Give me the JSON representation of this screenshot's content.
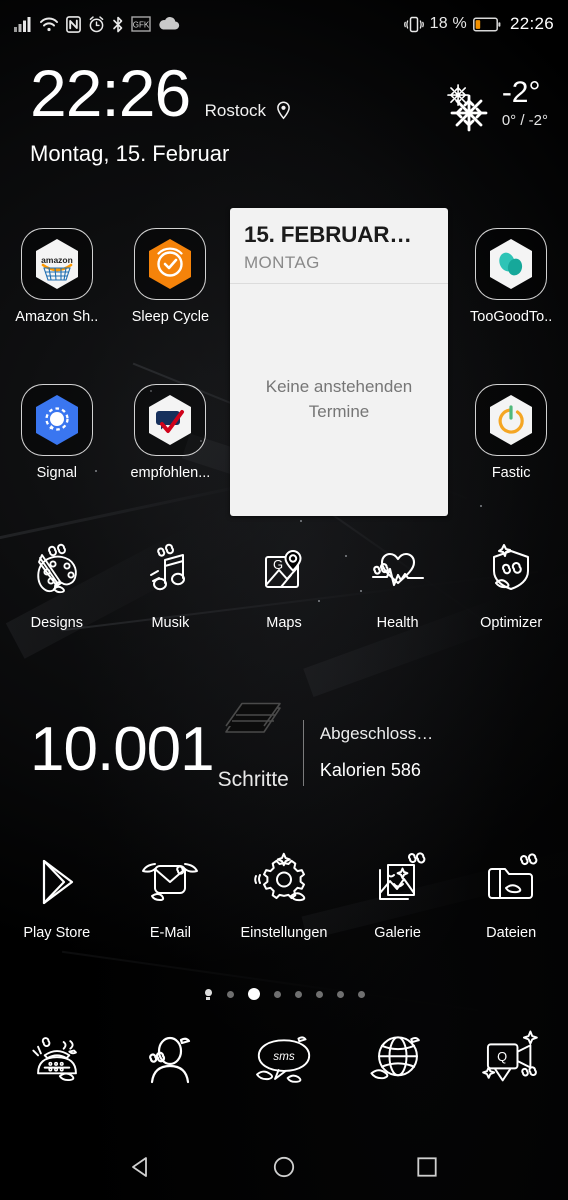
{
  "statusbar": {
    "left_icons": [
      "signal-bars-icon",
      "wifi-icon",
      "nfc-icon",
      "alarm-icon",
      "bluetooth-icon",
      "gfk-icon",
      "cloud-icon"
    ],
    "gfk_label": "GFK",
    "battery_percent": "18 %",
    "time": "22:26",
    "vibrate_icon": "vibrate-icon",
    "battery_icon": "battery-low-icon",
    "battery_color": "#f29100"
  },
  "clock_widget": {
    "time": "22:26",
    "city": "Rostock",
    "location_icon": "location-pin-icon",
    "date": "Montag, 15. Februar"
  },
  "weather_widget": {
    "icon": "snowflake-icon",
    "temperature": "-2°",
    "range": "0° / -2°"
  },
  "calendar_widget": {
    "date": "15. FEBRUAR…",
    "weekday": "MONTAG",
    "empty_message": "Keine anstehenden Termine"
  },
  "steps_widget": {
    "count": "10.001",
    "unit": "Schritte",
    "goal": "Abgeschloss…",
    "calories": "Kalorien 586",
    "book_icon": "book-stack-icon"
  },
  "rows": [
    {
      "name": "app-row-1",
      "apps": [
        {
          "label": "Amazon Sh..",
          "icon": "amazon-shopping-icon",
          "style": "hex-white"
        },
        {
          "label": "Sleep Cycle",
          "icon": "sleep-cycle-icon",
          "style": "hex-orange"
        },
        {
          "label": "",
          "icon": "",
          "style": "spacer"
        },
        {
          "label": "",
          "icon": "",
          "style": "spacer"
        },
        {
          "label": "TooGoodTo..",
          "icon": "toogoodtogo-icon",
          "style": "hex-white"
        }
      ]
    },
    {
      "name": "app-row-2",
      "apps": [
        {
          "label": "Signal",
          "icon": "signal-app-icon",
          "style": "hex-blue"
        },
        {
          "label": "empfohlen...",
          "icon": "empfohlen-icon",
          "style": "hex-white"
        },
        {
          "label": "",
          "icon": "",
          "style": "spacer"
        },
        {
          "label": "",
          "icon": "",
          "style": "spacer"
        },
        {
          "label": "Fastic",
          "icon": "fastic-icon",
          "style": "hex-white"
        }
      ]
    },
    {
      "name": "app-row-3",
      "apps": [
        {
          "label": "Designs",
          "icon": "palette-icon",
          "style": "line"
        },
        {
          "label": "Musik",
          "icon": "music-note-icon",
          "style": "line"
        },
        {
          "label": "Maps",
          "icon": "maps-icon",
          "style": "line"
        },
        {
          "label": "Health",
          "icon": "heart-pulse-icon",
          "style": "line"
        },
        {
          "label": "Optimizer",
          "icon": "shield-icon",
          "style": "line"
        }
      ]
    },
    {
      "name": "app-row-4",
      "apps": [
        {
          "label": "Play Store",
          "icon": "play-store-icon",
          "style": "line"
        },
        {
          "label": "E-Mail",
          "icon": "envelope-wings-icon",
          "style": "line"
        },
        {
          "label": "Einstellungen",
          "icon": "gear-icon",
          "style": "line"
        },
        {
          "label": "Galerie",
          "icon": "gallery-icon",
          "style": "line"
        },
        {
          "label": "Dateien",
          "icon": "folder-icon",
          "style": "line"
        }
      ]
    }
  ],
  "page_indicator": {
    "total": 8,
    "active_index": 2,
    "home_index": 0
  },
  "dock": [
    {
      "label": "",
      "icon": "phone-icon"
    },
    {
      "label": "",
      "icon": "contacts-icon"
    },
    {
      "label": "",
      "icon": "sms-icon"
    },
    {
      "label": "",
      "icon": "browser-globe-icon"
    },
    {
      "label": "",
      "icon": "camera-icon"
    }
  ],
  "navbar": [
    {
      "name": "back-button",
      "icon": "back-triangle-icon"
    },
    {
      "name": "home-button",
      "icon": "home-circle-icon"
    },
    {
      "name": "recents-button",
      "icon": "recents-square-icon"
    }
  ]
}
